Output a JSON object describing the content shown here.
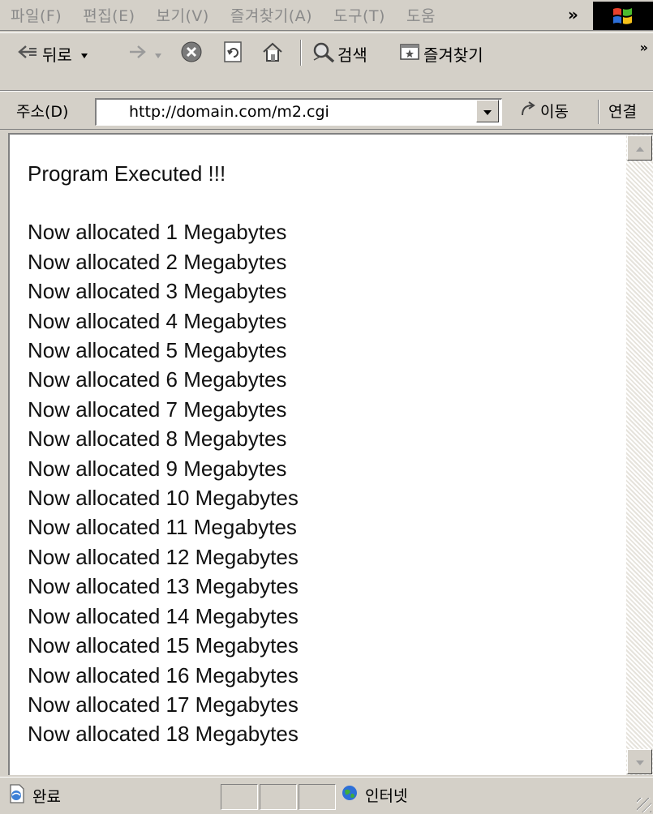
{
  "menubar": {
    "items": [
      "파일(F)",
      "편집(E)",
      "보기(V)",
      "즐겨찾기(A)",
      "도구(T)",
      "도움"
    ],
    "overflow": "»"
  },
  "toolbar": {
    "back_label": "뒤로",
    "search_label": "검색",
    "favorites_label": "즐겨찾기",
    "overflow": "»"
  },
  "address": {
    "label": "주소(D)",
    "url": "http://domain.com/m2.cgi",
    "go_label": "이동",
    "links_label": "연결"
  },
  "content": {
    "heading": "Program Executed !!!",
    "lines": [
      "Now allocated 1 Megabytes",
      "Now allocated 2 Megabytes",
      "Now allocated 3 Megabytes",
      "Now allocated 4 Megabytes",
      "Now allocated 5 Megabytes",
      "Now allocated 6 Megabytes",
      "Now allocated 7 Megabytes",
      "Now allocated 8 Megabytes",
      "Now allocated 9 Megabytes",
      "Now allocated 10 Megabytes",
      "Now allocated 11 Megabytes",
      "Now allocated 12 Megabytes",
      "Now allocated 13 Megabytes",
      "Now allocated 14 Megabytes",
      "Now allocated 15 Megabytes",
      "Now allocated 16 Megabytes",
      "Now allocated 17 Megabytes",
      "Now allocated 18 Megabytes"
    ]
  },
  "status": {
    "text": "완료",
    "zone": "인터넷"
  },
  "colors": {
    "chrome": "#d4d0c8",
    "disabled_text": "#8a8a8a",
    "page_bg": "#ffffff"
  },
  "icons": [
    "back-arrow-icon",
    "dropdown-arrow-icon",
    "forward-arrow-icon",
    "stop-icon",
    "refresh-icon",
    "home-icon",
    "search-icon",
    "favorites-icon",
    "go-icon",
    "windows-logo-icon",
    "page-done-icon",
    "internet-zone-icon",
    "scroll-up-icon",
    "scroll-down-icon"
  ]
}
